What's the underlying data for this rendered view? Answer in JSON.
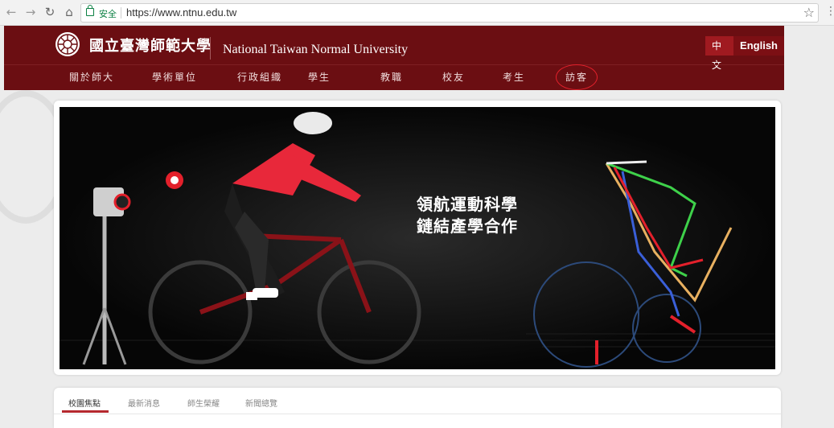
{
  "browser": {
    "secure_label": "安全",
    "url": "https://www.ntnu.edu.tw"
  },
  "header": {
    "cn_name": "國立臺灣師範大學",
    "en_name": "National Taiwan Normal University",
    "lang_zh": "中文",
    "lang_en": "English"
  },
  "menu": [
    "關於師大",
    "學術單位",
    "行政組織",
    "學生",
    "教職",
    "校友",
    "考生",
    "訪客"
  ],
  "hero": {
    "line1": "領航運動科學",
    "line2": "鏈結產學合作"
  },
  "news_tabs": [
    "校園焦點",
    "最新消息",
    "師生榮耀",
    "新聞總覽"
  ],
  "colors": {
    "header_bg": "#6b0e12",
    "accent": "#b5282e",
    "annotation": "#e3202b"
  }
}
